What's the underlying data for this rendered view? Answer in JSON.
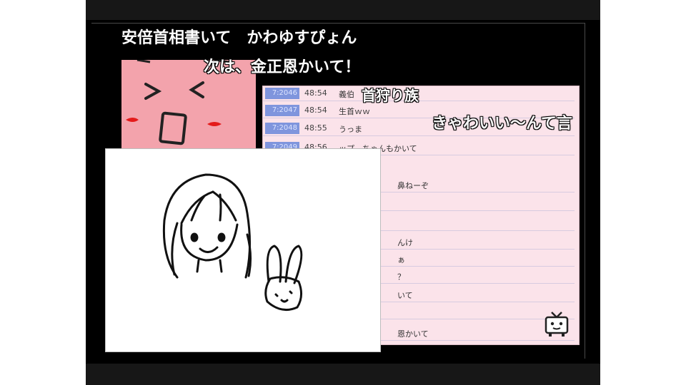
{
  "video": {
    "overlay_comments": [
      "安倍首相書いて　かわゆすぴょん",
      "次は、金正恩かいて！",
      "首狩り族",
      "きゃわいい〜んて言"
    ],
    "comment_list": {
      "rows": [
        {
          "no": "7:2046",
          "time": "48:54",
          "msg": "義伯"
        },
        {
          "no": "7:2047",
          "time": "48:54",
          "msg": "生首ｗｗ"
        },
        {
          "no": "7:2048",
          "time": "48:55",
          "msg": "うっま"
        },
        {
          "no": "7:2049",
          "time": "48:56",
          "msg": "ップ…ちゃんもかいて"
        },
        {
          "msg": "鼻ねーぞ"
        },
        {
          "msg": "んけ"
        },
        {
          "msg": "ぁ"
        },
        {
          "msg": "？"
        },
        {
          "msg": "いて"
        },
        {
          "msg": "恩かいて"
        }
      ]
    },
    "colors": {
      "stage_bg": "#000000",
      "face_panel": "#f3a3ac",
      "list_bg": "#fbe3ea",
      "row_number_bg": "#7f95dd"
    },
    "icons": [
      "niconico-tv-logo-icon"
    ]
  }
}
